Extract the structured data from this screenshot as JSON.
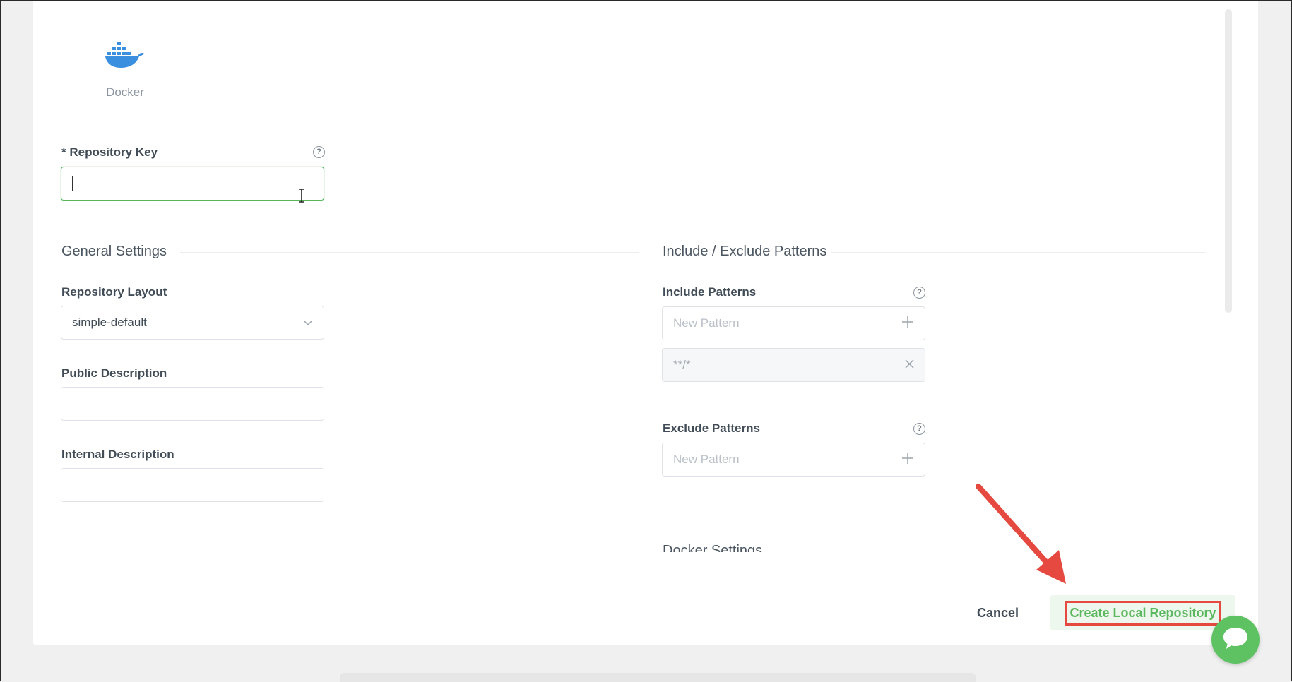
{
  "package_type": {
    "label": "Docker",
    "icon": "docker-whale-icon",
    "icon_color": "#3a8fde"
  },
  "repository_key": {
    "label": "* Repository Key",
    "value": "",
    "help_icon": "question-circle-icon"
  },
  "general_settings": {
    "title": "General Settings",
    "repository_layout": {
      "label": "Repository Layout",
      "value": "simple-default",
      "dropdown_icon": "chevron-down-icon"
    },
    "public_description": {
      "label": "Public Description",
      "value": ""
    },
    "internal_description": {
      "label": "Internal Description",
      "value": ""
    }
  },
  "patterns": {
    "title": "Include / Exclude Patterns",
    "include": {
      "label": "Include Patterns",
      "placeholder": "New Pattern",
      "items": [
        "**/*"
      ]
    },
    "exclude": {
      "label": "Exclude Patterns",
      "placeholder": "New Pattern",
      "items": []
    }
  },
  "next_section_title": "Docker Settings",
  "footer": {
    "cancel_label": "Cancel",
    "create_label": "Create Local Repository"
  },
  "colors": {
    "accent_green": "#5cb85f",
    "focus_border": "#57b65a",
    "annotation_red": "#e5493f"
  },
  "chat_widget": {
    "icon": "chat-bubble-icon"
  }
}
